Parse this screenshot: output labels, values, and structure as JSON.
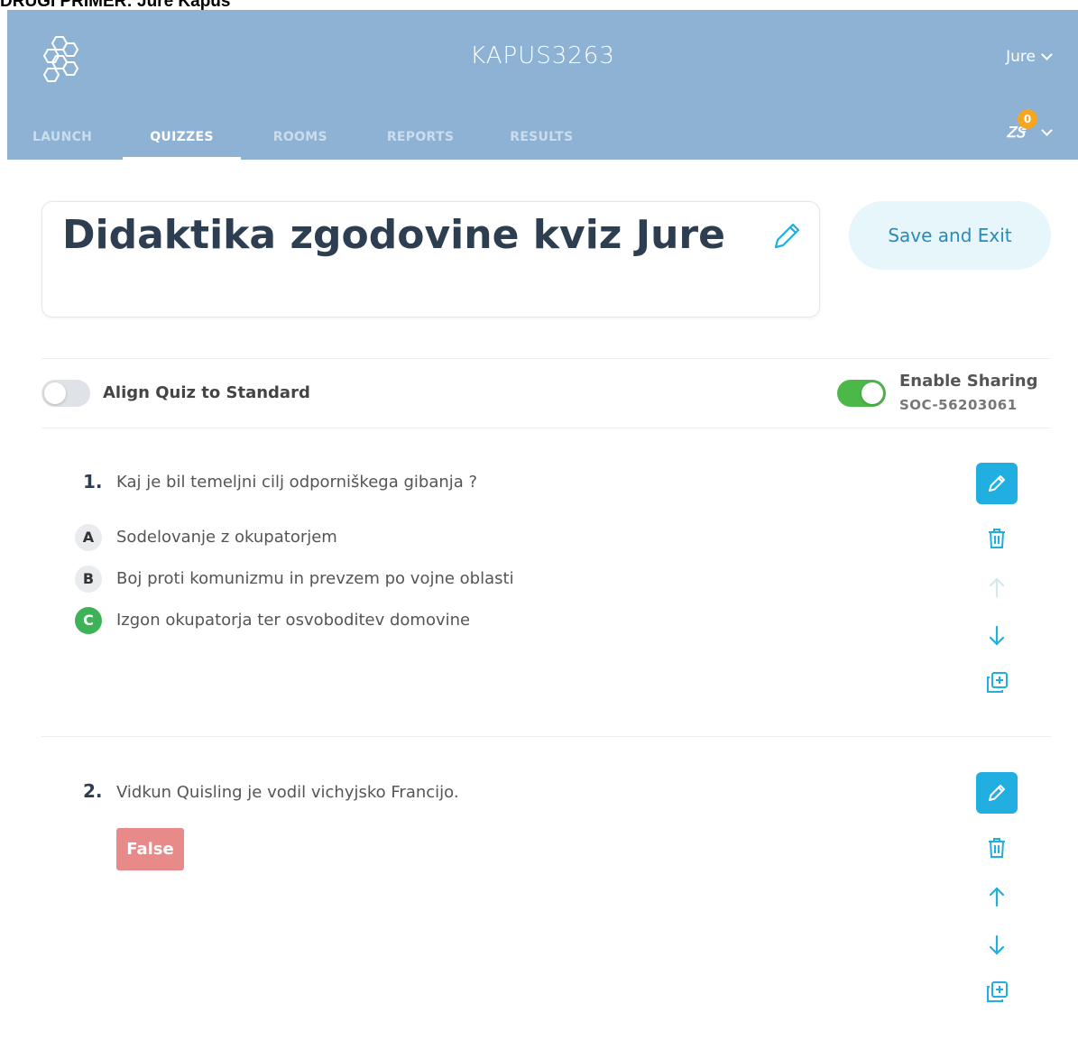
{
  "document": {
    "caption": "DRUGI PRIMER: Jure Kapus"
  },
  "header": {
    "room_code": "KAPUS3263",
    "user_name": "Jure",
    "badge_count": "0",
    "badge_glyph": "ᏃᏕ"
  },
  "nav": {
    "tabs": [
      {
        "label": "LAUNCH"
      },
      {
        "label": "QUIZZES"
      },
      {
        "label": "ROOMS"
      },
      {
        "label": "REPORTS"
      },
      {
        "label": "RESULTS"
      }
    ],
    "active": "QUIZZES"
  },
  "quiz": {
    "title": "Didaktika zgodovine kviz Jure",
    "save_exit_label": "Save and Exit"
  },
  "settings": {
    "align_label": "Align Quiz to Standard",
    "align_enabled": false,
    "sharing_label": "Enable Sharing",
    "sharing_code": "SOC-56203061",
    "sharing_enabled": true
  },
  "questions": [
    {
      "number": "1.",
      "text": "Kaj je bil temeljni cilj odporniškega gibanja ?",
      "options": [
        {
          "letter": "A",
          "text": "Sodelovanje z okupatorjem",
          "correct": false
        },
        {
          "letter": "B",
          "text": "Boj proti komunizmu in prevzem po vojne oblasti",
          "correct": false
        },
        {
          "letter": "C",
          "text": "Izgon okupatorja ter osvoboditev domovine",
          "correct": true
        }
      ]
    },
    {
      "number": "2.",
      "text": "Vidkun Quisling je vodil vichyjsko Francijo.",
      "answer": "False"
    }
  ],
  "colors": {
    "header_bg": "#8db2d4",
    "edit_button": "#21aee0",
    "action_icon": "#21aee0",
    "correct_answer": "#3db257",
    "false_badge": "#e88a8a",
    "toggle_on": "#4cb848"
  }
}
